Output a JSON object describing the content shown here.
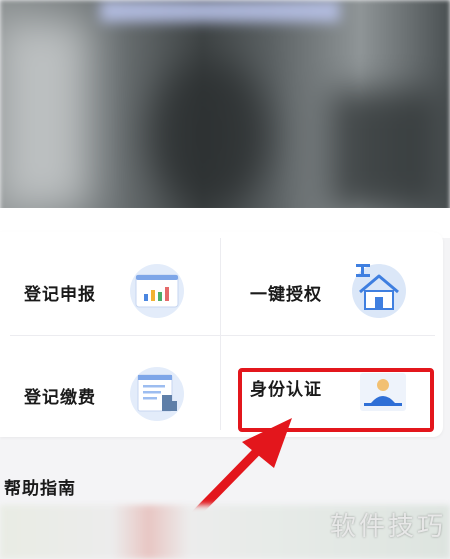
{
  "services": {
    "registration_report": {
      "label": "登记申报",
      "icon": "chart-document-icon"
    },
    "one_click_authorize": {
      "label": "一键授权",
      "icon": "house-icon"
    },
    "registration_payment": {
      "label": "登记缴费",
      "icon": "payment-document-icon"
    },
    "identity_verify": {
      "label": "身份认证",
      "icon": "user-id-card-icon"
    }
  },
  "help_guide": {
    "title": "帮助指南"
  },
  "watermark": "软件技巧",
  "colors": {
    "highlight": "#e3161c",
    "icon_bg": "#dbe7f8",
    "icon_primary": "#3f7fe0"
  }
}
